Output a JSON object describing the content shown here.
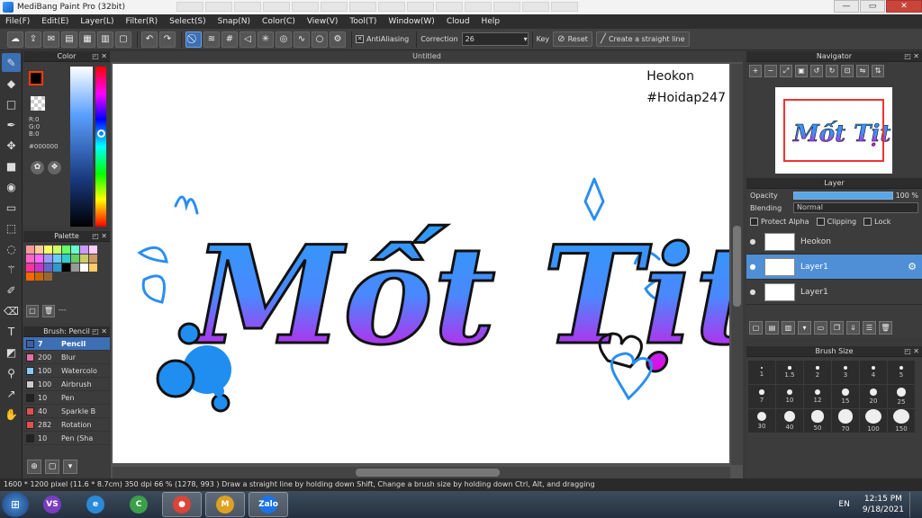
{
  "window": {
    "title": "MediBang Paint Pro (32bit)",
    "controls": [
      "—",
      "▭",
      "✕"
    ]
  },
  "menu": [
    "File(F)",
    "Edit(E)",
    "Layer(L)",
    "Filter(R)",
    "Select(S)",
    "Snap(N)",
    "Color(C)",
    "View(V)",
    "Tool(T)",
    "Window(W)",
    "Cloud",
    "Help"
  ],
  "toolbar": {
    "antialiasing_label": "AntiAliasing",
    "correction_label": "Correction",
    "correction_value": "26",
    "key_label": "Key",
    "reset_label": "Reset",
    "straight_line_label": "Create a straight line"
  },
  "color_panel": {
    "title": "Color",
    "r": "R:0",
    "g": "G:0",
    "b": "B:0",
    "hex": "#000000",
    "foreground": "#000000",
    "background": "#ff5a00"
  },
  "palette_panel": {
    "title": "Palette",
    "dash": "---",
    "swatches": [
      "#ff9999",
      "#ffcc99",
      "#ffff66",
      "#ccff66",
      "#66ff66",
      "#66ffcc",
      "#cc99ff",
      "#ffccff",
      "#ff66cc",
      "#ff66ff",
      "#9999ff",
      "#66ccff",
      "#33cccc",
      "#66cc66",
      "#cccc66",
      "#cc9966",
      "#ff3399",
      "#cc33cc",
      "#6666cc",
      "#3399cc",
      "#000000",
      "#999999",
      "#ffffff",
      "#ffcc66",
      "#ff6600",
      "#cc6600",
      "#996633"
    ]
  },
  "brush_panel": {
    "title": "Brush: Pencil",
    "items": [
      {
        "size": "7",
        "name": "Pencil",
        "color": "#3b5fa8",
        "selected": true
      },
      {
        "size": "200",
        "name": "Blur",
        "color": "#e76fa8",
        "selected": false
      },
      {
        "size": "100",
        "name": "Watercolor",
        "color": "#86c8ff",
        "selected": false
      },
      {
        "size": "100",
        "name": "Airbrush",
        "color": "#cccccc",
        "selected": false
      },
      {
        "size": "10",
        "name": "Pen",
        "color": "#222222",
        "selected": false
      },
      {
        "size": "40",
        "name": "Sparkle B",
        "color": "#e05050",
        "selected": false
      },
      {
        "size": "282",
        "name": "Rotation",
        "color": "#e05050",
        "selected": false
      },
      {
        "size": "10",
        "name": "Pen (Sha",
        "color": "#222222",
        "selected": false
      }
    ]
  },
  "canvas": {
    "tab_title": "Untitled",
    "artwork_text": "Mốt Tịt",
    "watermark_line1": "Heokon",
    "watermark_line2": "#Hoidap247"
  },
  "navigator_panel": {
    "title": "Navigator"
  },
  "layer_panel": {
    "title": "Layer",
    "opacity_label": "Opacity",
    "opacity_value": "100 %",
    "opacity_level": 1.0,
    "blending_label": "Blending",
    "blending_value": "Normal",
    "protect_alpha": "Protect Alpha",
    "clipping": "Clipping",
    "lock": "Lock",
    "layers": [
      {
        "name": "Heokon",
        "selected": false
      },
      {
        "name": "Layer1",
        "selected": true
      },
      {
        "name": "Layer1",
        "selected": false
      }
    ]
  },
  "brush_size_panel": {
    "title": "Brush Size",
    "sizes": [
      "1",
      "1.5",
      "2",
      "3",
      "4",
      "5",
      "7",
      "10",
      "12",
      "15",
      "20",
      "25",
      "30",
      "40",
      "50",
      "70",
      "100",
      "150"
    ]
  },
  "statusbar": {
    "text": "1600 * 1200 pixel  (11.6 * 8.7cm)  350 dpi  66 %   (1278, 993 )  Draw a straight line by holding down Shift, Change a brush size by holding down Ctrl, Alt, and dragging"
  },
  "taskbar": {
    "apps": [
      {
        "name": "visual-studio",
        "color": "#7a3dbf",
        "glyph": "VS"
      },
      {
        "name": "internet-explorer",
        "color": "#2a8ad8",
        "glyph": "e"
      },
      {
        "name": "cc-cleaner",
        "color": "#3aa04a",
        "glyph": "C"
      },
      {
        "name": "chrome",
        "color": "#db4437",
        "glyph": "●"
      },
      {
        "name": "medibang",
        "color": "#e0a020",
        "glyph": "M"
      },
      {
        "name": "zalo",
        "color": "#1a73e8",
        "glyph": "Zalo"
      }
    ],
    "language": "EN",
    "time": "12:15 PM",
    "date": "9/18/2021"
  }
}
